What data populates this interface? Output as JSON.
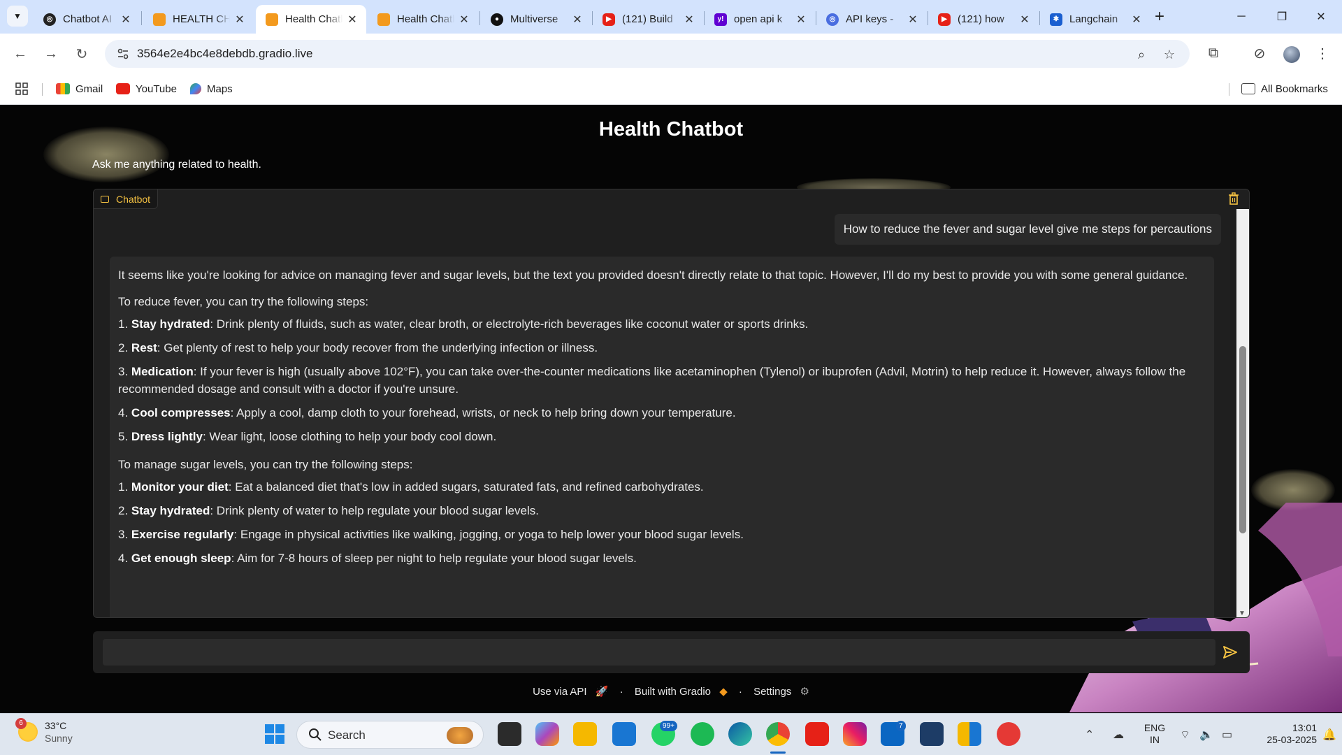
{
  "browser": {
    "tabs": [
      {
        "title": "Chatbot AI",
        "active": false,
        "icon": "openai-icon"
      },
      {
        "title": "HEALTH CHATBOT",
        "active": false,
        "icon": "gradio-icon"
      },
      {
        "title": "Health Chatbot",
        "active": true,
        "icon": "gradio-icon"
      },
      {
        "title": "Health Chatbot",
        "active": false,
        "icon": "gradio-icon"
      },
      {
        "title": "Multiverse",
        "active": false,
        "icon": "github-icon"
      },
      {
        "title": "(121) Build",
        "active": false,
        "icon": "youtube-icon"
      },
      {
        "title": "open api k",
        "active": false,
        "icon": "yahoo-icon"
      },
      {
        "title": "API keys -",
        "active": false,
        "icon": "openai-icon"
      },
      {
        "title": "(121) how",
        "active": false,
        "icon": "youtube-icon"
      },
      {
        "title": "Langchain",
        "active": false,
        "icon": "langchain-icon"
      }
    ],
    "url": "3564e2e4bc4e8debdb.gradio.live",
    "bookmarks": [
      "Gmail",
      "YouTube",
      "Maps"
    ],
    "all_bookmarks": "All Bookmarks"
  },
  "app": {
    "title": "Health Chatbot",
    "description": "Ask me anything related to health.",
    "chatbot_label": "Chatbot",
    "user_message": "How to reduce the fever and sugar level give me steps for percautions",
    "bot_intro": "It seems like you're looking for advice on managing fever and sugar levels, but the text you provided doesn't directly relate to that topic. However, I'll do my best to provide you with some general guidance.",
    "fever_heading": "To reduce fever, you can try the following steps:",
    "fever_steps": [
      {
        "num": "1.",
        "title": "Stay hydrated",
        "text": ": Drink plenty of fluids, such as water, clear broth, or electrolyte-rich beverages like coconut water or sports drinks."
      },
      {
        "num": "2.",
        "title": "Rest",
        "text": ": Get plenty of rest to help your body recover from the underlying infection or illness."
      },
      {
        "num": "3.",
        "title": "Medication",
        "text": ": If your fever is high (usually above 102°F), you can take over-the-counter medications like acetaminophen (Tylenol) or ibuprofen (Advil, Motrin) to help reduce it. However, always follow the recommended dosage and consult with a doctor if you're unsure."
      },
      {
        "num": "4.",
        "title": "Cool compresses",
        "text": ": Apply a cool, damp cloth to your forehead, wrists, or neck to help bring down your temperature."
      },
      {
        "num": "5.",
        "title": "Dress lightly",
        "text": ": Wear light, loose clothing to help your body cool down."
      }
    ],
    "sugar_heading": "To manage sugar levels, you can try the following steps:",
    "sugar_steps": [
      {
        "num": "1.",
        "title": "Monitor your diet",
        "text": ": Eat a balanced diet that's low in added sugars, saturated fats, and refined carbohydrates."
      },
      {
        "num": "2.",
        "title": "Stay hydrated",
        "text": ": Drink plenty of water to help regulate your blood sugar levels."
      },
      {
        "num": "3.",
        "title": "Exercise regularly",
        "text": ": Engage in physical activities like walking, jogging, or yoga to help lower your blood sugar levels."
      },
      {
        "num": "4.",
        "title": "Get enough sleep",
        "text": ": Aim for 7-8 hours of sleep per night to help regulate your blood sugar levels."
      }
    ],
    "input_value": "",
    "footer": {
      "api": "Use via API",
      "built": "Built with Gradio",
      "settings": "Settings",
      "sep": "·"
    },
    "accent_color": "#f5c242"
  },
  "taskbar": {
    "weather_badge": "6",
    "temperature": "33°C",
    "condition": "Sunny",
    "search_label": "Search",
    "whatsapp_badge": "99+",
    "linkedin_badge": "7",
    "lang_top": "ENG",
    "lang_bottom": "IN",
    "time": "13:01",
    "date": "25-03-2025"
  }
}
